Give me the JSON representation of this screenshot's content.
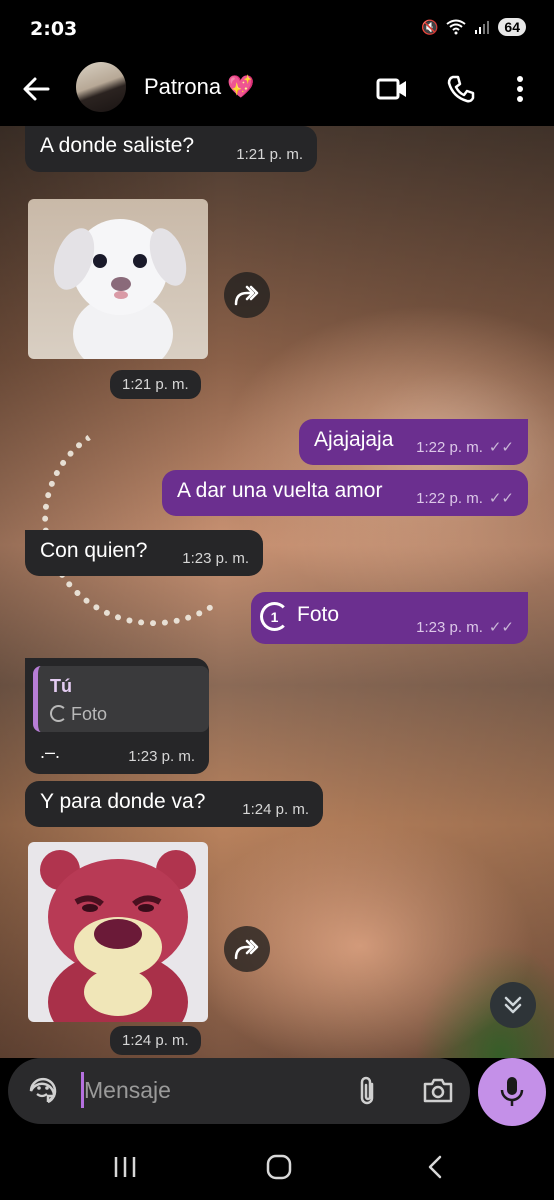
{
  "status_bar": {
    "time": "2:03",
    "battery": "64"
  },
  "header": {
    "contact_name": "Patrona 💖"
  },
  "messages": [
    {
      "dir": "in",
      "text": "A donde saliste?",
      "time": "1:21 p. m."
    },
    {
      "dir": "in",
      "type": "sticker",
      "sticker": "puppy-sticker",
      "time": "1:21 p. m."
    },
    {
      "dir": "out",
      "text": "Ajajajaja",
      "time": "1:22 p. m."
    },
    {
      "dir": "out",
      "text": "A dar una vuelta amor",
      "time": "1:22 p. m."
    },
    {
      "dir": "in",
      "text": "Con quien?",
      "time": "1:23 p. m."
    },
    {
      "dir": "out",
      "type": "view-once",
      "text": "Foto",
      "view_once_count": "1",
      "time": "1:23 p. m."
    },
    {
      "dir": "in",
      "reply_to": {
        "author": "Tú",
        "text": "Foto"
      },
      "text": ".–.",
      "time": "1:23 p. m."
    },
    {
      "dir": "in",
      "text": "Y para donde va?",
      "time": "1:24 p. m."
    },
    {
      "dir": "in",
      "type": "sticker",
      "sticker": "pink-bear-sticker",
      "time": "1:24 p. m."
    }
  ],
  "composer": {
    "placeholder": "Mensaje"
  },
  "colors": {
    "accent": "#6b2f8f",
    "mic": "#c490e8",
    "incoming": "#262628"
  }
}
